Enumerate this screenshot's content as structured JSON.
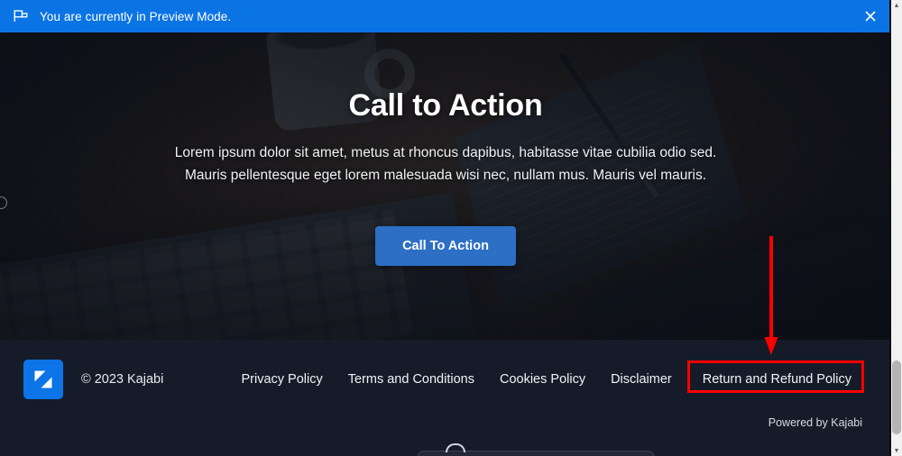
{
  "preview_banner": {
    "icon": "preview-flag-icon",
    "message": "You are currently in Preview Mode.",
    "close_label": "✕",
    "background_color": "#0b74e5"
  },
  "hero": {
    "title": "Call to Action",
    "subtitle_line1": "Lorem ipsum dolor sit amet, metus at rhoncus dapibus, habitasse vitae cubilia odio sed.",
    "subtitle_line2": "Mauris pellentesque eget lorem malesuada wisi nec, nullam mus. Mauris vel mauris.",
    "cta_label": "Call To Action",
    "cta_color": "#2c6fc4",
    "background_description": "dark desk photo with coffee mug, notepad, pen, laptop and phone"
  },
  "footer": {
    "logo_icon": "kajabi-logo-icon",
    "logo_color": "#0c74e6",
    "copyright": "© 2023 Kajabi",
    "links": [
      {
        "label": "Privacy Policy",
        "highlighted": false
      },
      {
        "label": "Terms and Conditions",
        "highlighted": false
      },
      {
        "label": "Cookies Policy",
        "highlighted": false
      },
      {
        "label": "Disclaimer",
        "highlighted": false
      },
      {
        "label": "Return and Refund Policy",
        "highlighted": true
      }
    ],
    "powered_by": "Powered by Kajabi",
    "background_color": "#161b29"
  },
  "annotations": {
    "arrow": {
      "shape": "down-arrow",
      "color": "#ff0000",
      "points_to": "Return and Refund Policy"
    },
    "box": {
      "shape": "rectangle",
      "color": "#ff0000",
      "surrounds": "Return and Refund Policy"
    }
  },
  "scrollbar": {
    "up_arrow": "▲",
    "down_arrow": "▼",
    "track_color": "#f1f1f1",
    "thumb_color": "#b4b4b4"
  }
}
